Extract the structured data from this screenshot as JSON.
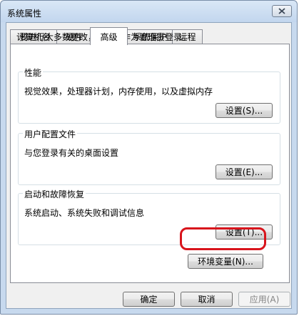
{
  "window": {
    "title": "系统属性"
  },
  "tabs": [
    {
      "label": "计算机名"
    },
    {
      "label": "硬件"
    },
    {
      "label": "高级"
    },
    {
      "label": "系统保护"
    },
    {
      "label": "远程"
    }
  ],
  "notice": "要进行大多数更改，您必须作为管理员登录。",
  "groups": {
    "performance": {
      "title": "性能",
      "desc": "视觉效果，处理器计划，内存使用，以及虚拟内存",
      "button": "设置(S)..."
    },
    "profiles": {
      "title": "用户配置文件",
      "desc": "与您登录有关的桌面设置",
      "button": "设置(E)..."
    },
    "startup": {
      "title": "启动和故障恢复",
      "desc": "系统启动、系统失败和调试信息",
      "button": "设置(T)..."
    }
  },
  "env_button": "环境变量(N)...",
  "footer": {
    "ok": "确定",
    "cancel": "取消",
    "apply": "应用(A)"
  }
}
